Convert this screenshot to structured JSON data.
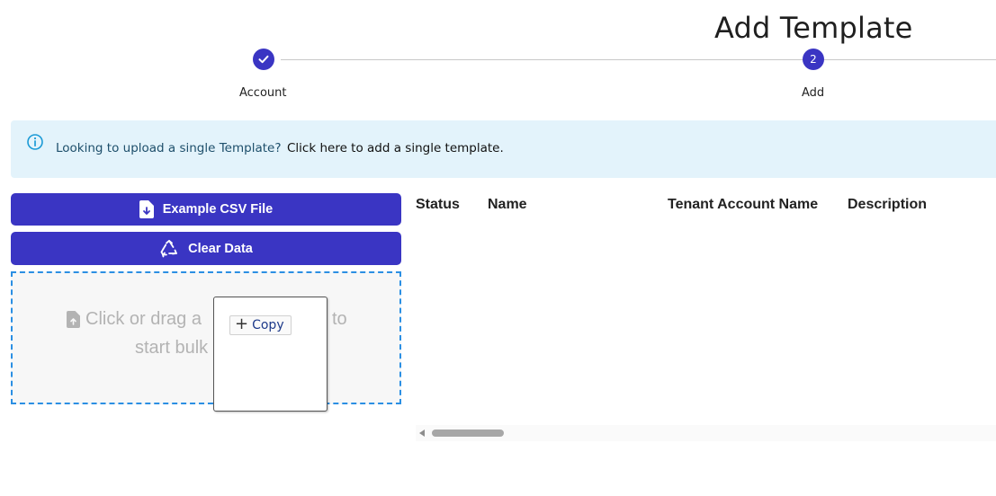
{
  "page": {
    "title": "Add Template"
  },
  "stepper": {
    "steps": [
      {
        "label": "Account",
        "state": "complete",
        "icon": "check-icon"
      },
      {
        "label": "Add",
        "number": "2",
        "state": "active"
      }
    ],
    "accent_color": "#3a35c3"
  },
  "info_banner": {
    "icon": "info-icon",
    "message": "Looking to upload a single Template?",
    "link_text": "Click here to add a single template."
  },
  "buttons": {
    "example_csv": {
      "label": "Example CSV File",
      "icon": "file-download-icon"
    },
    "clear_data": {
      "label": "Clear Data",
      "icon": "recycle-icon"
    }
  },
  "dropzone": {
    "line1_visible": "Click or drag a",
    "line1_end": "to",
    "line2_visible": "start bulk",
    "icon": "file-upload-icon",
    "border_color": "#2b8fe3"
  },
  "context_popup": {
    "copy_label": "Copy",
    "icon": "plus-icon"
  },
  "table": {
    "columns": [
      "Status",
      "Name",
      "Tenant Account Name",
      "Description"
    ],
    "rows": []
  }
}
